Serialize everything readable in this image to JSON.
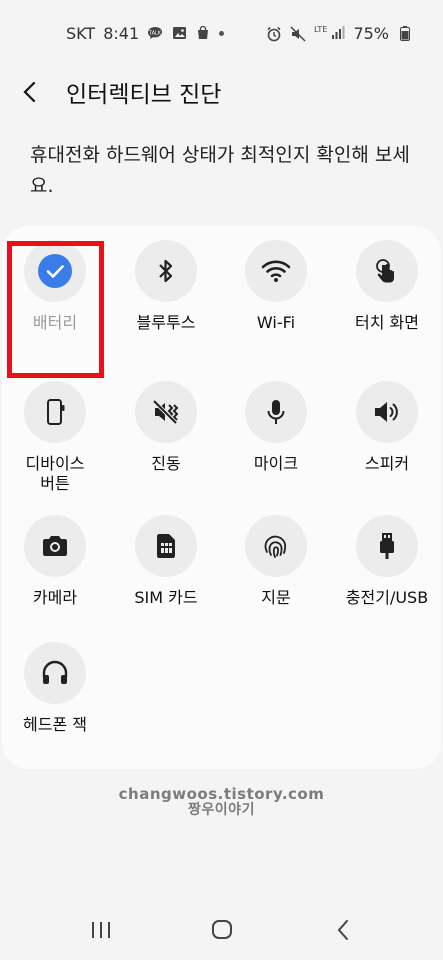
{
  "status_bar": {
    "carrier": "SKT",
    "time": "8:41",
    "network": "LTE",
    "battery": "75%"
  },
  "header": {
    "title": "인터렉티브 진단"
  },
  "description": "휴대전화 하드웨어 상태가 최적인지 확인해 보세요.",
  "items": [
    {
      "label": "배터리",
      "icon": "check-icon",
      "state": "completed"
    },
    {
      "label": "블루투스",
      "icon": "bluetooth-icon"
    },
    {
      "label": "Wi-Fi",
      "icon": "wifi-icon"
    },
    {
      "label": "터치 화면",
      "icon": "touch-icon"
    },
    {
      "label": "디바이스\n버튼",
      "icon": "device-button-icon"
    },
    {
      "label": "진동",
      "icon": "vibration-icon"
    },
    {
      "label": "마이크",
      "icon": "microphone-icon"
    },
    {
      "label": "스피커",
      "icon": "speaker-icon"
    },
    {
      "label": "카메라",
      "icon": "camera-icon"
    },
    {
      "label": "SIM 카드",
      "icon": "sim-card-icon"
    },
    {
      "label": "지문",
      "icon": "fingerprint-icon"
    },
    {
      "label": "충전기/USB",
      "icon": "usb-icon"
    },
    {
      "label": "헤드폰 잭",
      "icon": "headphone-icon"
    }
  ],
  "watermark": {
    "line1": "changwoos.tistory.com",
    "line2": "짱우이야기"
  },
  "colors": {
    "accent": "#3b7de8",
    "highlight": "#e8111a"
  }
}
